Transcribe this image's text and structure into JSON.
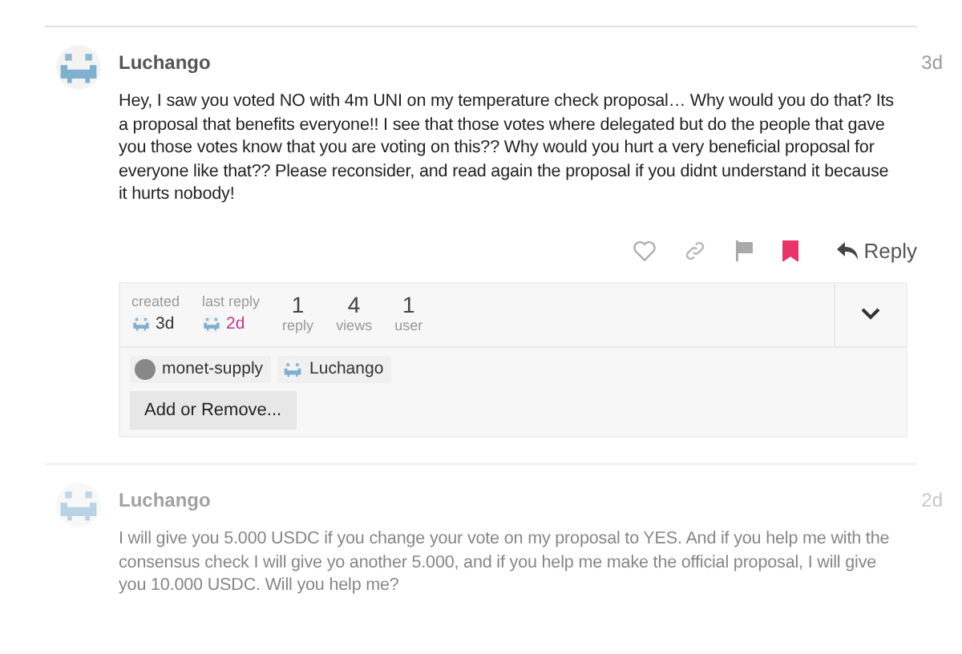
{
  "posts": [
    {
      "author": "Luchango",
      "time": "3d",
      "faded": false,
      "body": "Hey, I saw you voted NO with 4m UNI on my temperature check proposal… Why would you do that? Its a proposal that benefits everyone!! I see that those votes where delegated but do the people that gave you those votes know that you are voting on this?? Why would you hurt a very beneficial proposal for everyone like that?? Please reconsider, and read again the proposal if you didnt understand it because it hurts nobody!",
      "actions": {
        "bookmarked": true,
        "reply_label": "Reply"
      },
      "topic_map": {
        "created": {
          "label": "created",
          "value": "3d"
        },
        "last_reply": {
          "label": "last reply",
          "value": "2d"
        },
        "stats": [
          {
            "value": "1",
            "label": "reply"
          },
          {
            "value": "4",
            "label": "views"
          },
          {
            "value": "1",
            "label": "user"
          }
        ],
        "expanded": false,
        "participants": [
          {
            "name": "monet-supply",
            "kind": "circle"
          },
          {
            "name": "Luchango",
            "kind": "pixel"
          }
        ],
        "add_button": "Add or Remove..."
      }
    },
    {
      "author": "Luchango",
      "time": "2d",
      "faded": true,
      "body": "I will give you 5.000 USDC if you change your vote on my proposal to YES. And if you help me with the consensus check I will give yo another 5.000, and if you help me make the official proposal, I will give you 10.000 USDC. Will you help me?"
    }
  ]
}
